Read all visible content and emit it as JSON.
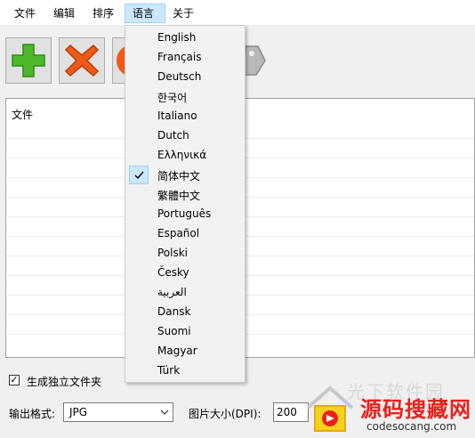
{
  "menubar": {
    "items": [
      "文件",
      "编辑",
      "排序",
      "语言",
      "关于"
    ],
    "active_index": 3
  },
  "toolbar": {
    "buttons": [
      {
        "icon": "add-icon",
        "color": "#4cb82a"
      },
      {
        "icon": "delete-icon",
        "color": "#f05a17"
      },
      {
        "icon": "convert-icon",
        "color": "#f05a17"
      },
      {
        "icon": "tag-icon",
        "color": "#9a9a9a"
      }
    ]
  },
  "file_list": {
    "header": "文件"
  },
  "options": {
    "separate_folder_label": "生成独立文件夹",
    "separate_folder_checked": true,
    "check_mark": "☑",
    "format_label": "输出格式:",
    "format_value": "JPG",
    "dpi_label": "图片大小(DPI):",
    "dpi_value": "200"
  },
  "language_menu": {
    "items": [
      "English",
      "Français",
      "Deutsch",
      "한국어",
      "Italiano",
      "Dutch",
      "Ελληνικά",
      "简体中文",
      "繁體中文",
      "Português",
      "Español",
      "Polski",
      "Česky",
      "العربية",
      "Dansk",
      "Suomi",
      "Magyar",
      "Türk"
    ],
    "selected": "简体中文"
  },
  "watermark": {
    "faint_text": "光下软件园",
    "title": "源码搜藏网",
    "url": "codesocang.com"
  }
}
